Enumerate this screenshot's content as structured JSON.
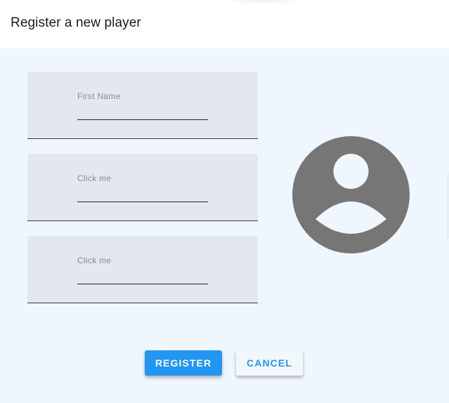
{
  "dialog": {
    "title": "Register a new player"
  },
  "form": {
    "first_name": {
      "label": "First Name",
      "value": ""
    },
    "field2": {
      "label": "Click me",
      "value": ""
    },
    "field3": {
      "label": "Click me",
      "value": ""
    }
  },
  "avatar": {
    "icon": "account-circle-icon",
    "color": "#767676"
  },
  "actions": {
    "register_label": "REGISTER",
    "cancel_label": "CANCEL"
  },
  "colors": {
    "accent": "#2196f3",
    "body_bg": "#eff6fd",
    "field_bg": "#e3e7ee"
  }
}
